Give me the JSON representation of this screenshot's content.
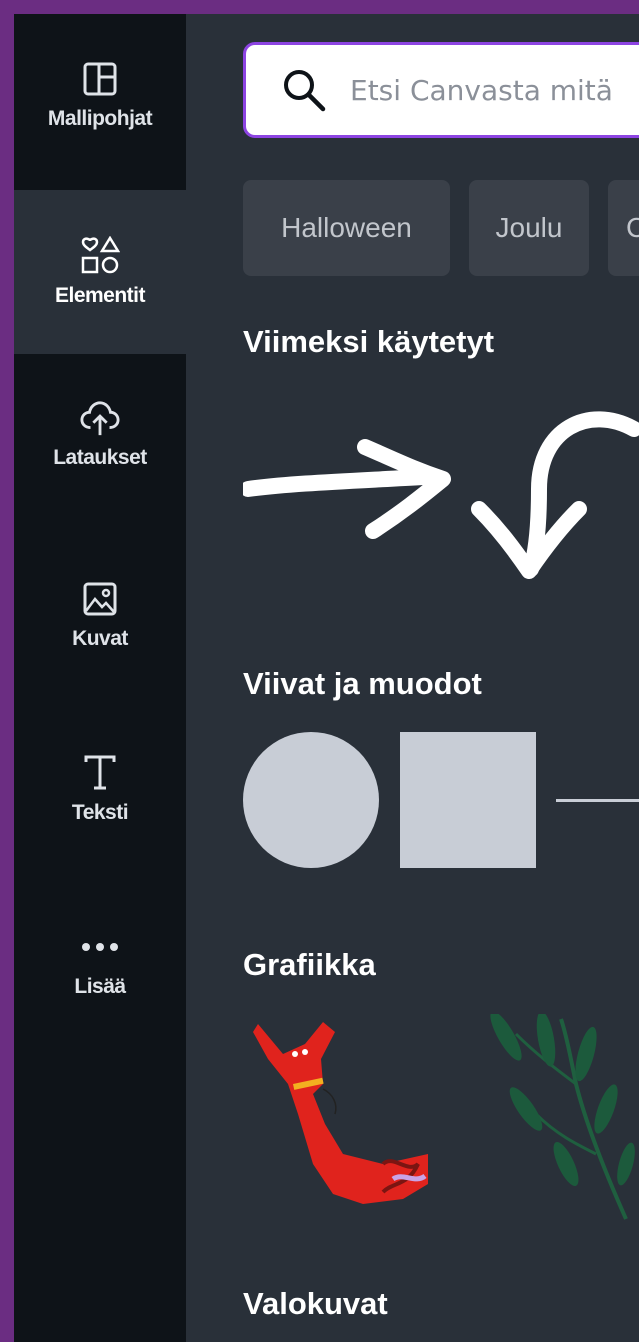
{
  "sidebar": {
    "items": [
      {
        "label": "Mallipohjat",
        "icon": "template-icon",
        "active": false
      },
      {
        "label": "Elementit",
        "icon": "shapes-icon",
        "active": true
      },
      {
        "label": "Lataukset",
        "icon": "cloud-upload-icon",
        "active": false
      },
      {
        "label": "Kuvat",
        "icon": "image-icon",
        "active": false
      },
      {
        "label": "Teksti",
        "icon": "text-icon",
        "active": false
      },
      {
        "label": "Lisää",
        "icon": "more-dots-icon",
        "active": false
      }
    ]
  },
  "search": {
    "placeholder": "Etsi Canvasta mitä"
  },
  "chips": [
    {
      "label": "Halloween"
    },
    {
      "label": "Joulu"
    },
    {
      "label": "C"
    }
  ],
  "sections": {
    "recent": "Viimeksi käytetyt",
    "lines_shapes": "Viivat ja muodot",
    "graphics": "Grafiikka",
    "photos": "Valokuvat"
  },
  "colors": {
    "frame_border": "#6b2d82",
    "sidebar_bg": "#0e1318",
    "panel_bg": "#293039",
    "accent": "#8d44e2",
    "shape_fill": "#c8cdd6"
  }
}
